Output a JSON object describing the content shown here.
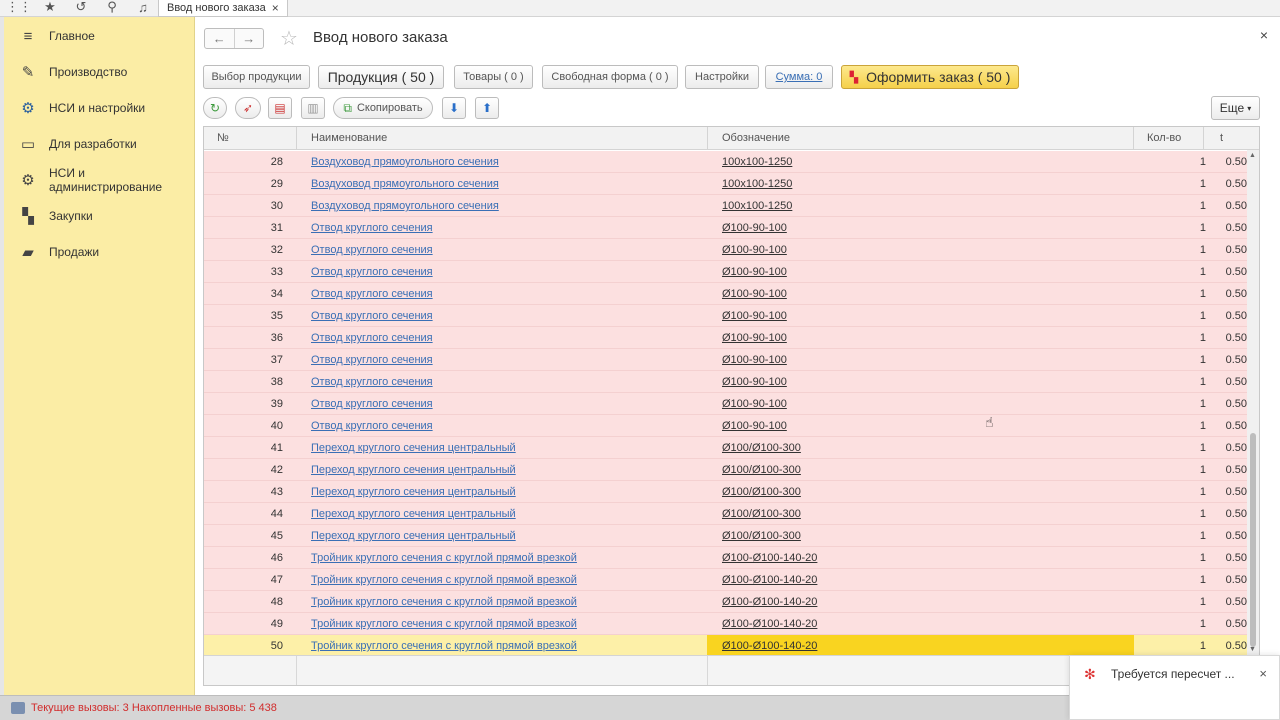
{
  "topbar": {
    "tab_title": "Ввод нового заказа",
    "tab_close": "×"
  },
  "sidebar": {
    "items": [
      {
        "label": "Главное",
        "icon": "menu-icon"
      },
      {
        "label": "Производство",
        "icon": "production-icon"
      },
      {
        "label": "НСИ и настройки",
        "icon": "gears-icon"
      },
      {
        "label": "Для разработки",
        "icon": "monitor-icon"
      },
      {
        "label": "НСИ и администрирование",
        "icon": "gear-icon"
      },
      {
        "label": "Закупки",
        "icon": "cart-icon"
      },
      {
        "label": "Продажи",
        "icon": "bag-icon"
      }
    ]
  },
  "header": {
    "title": "Ввод нового заказа",
    "close": "×"
  },
  "commands": {
    "select_products": "Выбор продукции",
    "products": "Продукция ( 50 )",
    "goods": "Товары ( 0 )",
    "free_form": "Свободная форма ( 0 )",
    "settings": "Настройки",
    "sum": "Сумма: 0",
    "place_order": "Оформить заказ ( 50 )"
  },
  "toolbar": {
    "copy": "Скопировать",
    "more": "Еще"
  },
  "table": {
    "columns": {
      "num": "№",
      "name": "Наименование",
      "code": "Обозначение",
      "qty": "Кол-во",
      "t": "t"
    },
    "rows": [
      {
        "num": "28",
        "name": "Воздуховод прямоугольного сечения",
        "code": "100x100-1250",
        "qty": "1",
        "t": "0.50"
      },
      {
        "num": "29",
        "name": "Воздуховод прямоугольного сечения",
        "code": "100x100-1250",
        "qty": "1",
        "t": "0.50"
      },
      {
        "num": "30",
        "name": "Воздуховод прямоугольного сечения",
        "code": "100x100-1250",
        "qty": "1",
        "t": "0.50"
      },
      {
        "num": "31",
        "name": "Отвод круглого сечения",
        "code": "Ø100-90-100",
        "qty": "1",
        "t": "0.50"
      },
      {
        "num": "32",
        "name": "Отвод круглого сечения",
        "code": "Ø100-90-100",
        "qty": "1",
        "t": "0.50"
      },
      {
        "num": "33",
        "name": "Отвод круглого сечения",
        "code": "Ø100-90-100",
        "qty": "1",
        "t": "0.50"
      },
      {
        "num": "34",
        "name": "Отвод круглого сечения",
        "code": "Ø100-90-100",
        "qty": "1",
        "t": "0.50"
      },
      {
        "num": "35",
        "name": "Отвод круглого сечения",
        "code": "Ø100-90-100",
        "qty": "1",
        "t": "0.50"
      },
      {
        "num": "36",
        "name": "Отвод круглого сечения",
        "code": "Ø100-90-100",
        "qty": "1",
        "t": "0.50"
      },
      {
        "num": "37",
        "name": "Отвод круглого сечения",
        "code": "Ø100-90-100",
        "qty": "1",
        "t": "0.50"
      },
      {
        "num": "38",
        "name": "Отвод круглого сечения",
        "code": "Ø100-90-100",
        "qty": "1",
        "t": "0.50"
      },
      {
        "num": "39",
        "name": "Отвод круглого сечения",
        "code": "Ø100-90-100",
        "qty": "1",
        "t": "0.50"
      },
      {
        "num": "40",
        "name": "Отвод круглого сечения",
        "code": "Ø100-90-100",
        "qty": "1",
        "t": "0.50"
      },
      {
        "num": "41",
        "name": "Переход круглого сечения центральный",
        "code": "Ø100/Ø100-300",
        "qty": "1",
        "t": "0.50"
      },
      {
        "num": "42",
        "name": "Переход круглого сечения центральный",
        "code": "Ø100/Ø100-300",
        "qty": "1",
        "t": "0.50"
      },
      {
        "num": "43",
        "name": "Переход круглого сечения центральный",
        "code": "Ø100/Ø100-300",
        "qty": "1",
        "t": "0.50"
      },
      {
        "num": "44",
        "name": "Переход круглого сечения центральный",
        "code": "Ø100/Ø100-300",
        "qty": "1",
        "t": "0.50"
      },
      {
        "num": "45",
        "name": "Переход круглого сечения центральный",
        "code": "Ø100/Ø100-300",
        "qty": "1",
        "t": "0.50"
      },
      {
        "num": "46",
        "name": "Тройник круглого сечения с круглой прямой врезкой",
        "code": "Ø100-Ø100-140-20",
        "qty": "1",
        "t": "0.50"
      },
      {
        "num": "47",
        "name": "Тройник круглого сечения с круглой прямой врезкой",
        "code": "Ø100-Ø100-140-20",
        "qty": "1",
        "t": "0.50"
      },
      {
        "num": "48",
        "name": "Тройник круглого сечения с круглой прямой врезкой",
        "code": "Ø100-Ø100-140-20",
        "qty": "1",
        "t": "0.50"
      },
      {
        "num": "49",
        "name": "Тройник круглого сечения с круглой прямой врезкой",
        "code": "Ø100-Ø100-140-20",
        "qty": "1",
        "t": "0.50"
      },
      {
        "num": "50",
        "name": "Тройник круглого сечения с круглой прямой врезкой",
        "code": "Ø100-Ø100-140-20",
        "qty": "1",
        "t": "0.50"
      }
    ],
    "selected_row": 22
  },
  "status": {
    "text": "Текущие вызовы: 3   Накопленные вызовы: 5 438"
  },
  "notification": {
    "text": "Требуется пересчет ...",
    "close": "×"
  },
  "colors": {
    "sidebar_bg": "#fbeda5",
    "row_bg": "#fce0e0",
    "selected_row_bg": "#fdf0a8",
    "selected_cell_bg": "#f9d420",
    "link": "#3a6fb5",
    "status_text": "#d12d2d"
  }
}
